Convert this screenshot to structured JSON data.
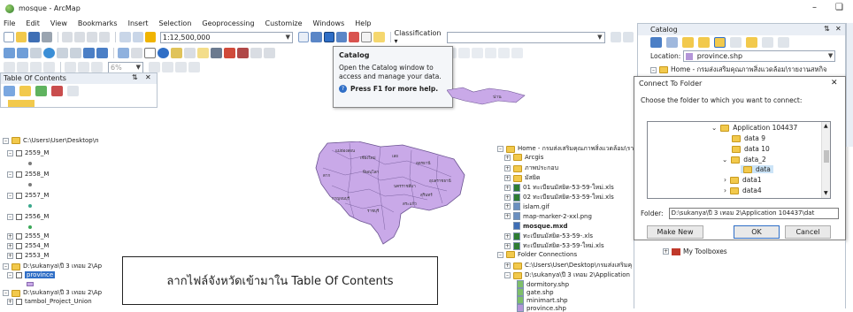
{
  "window": {
    "title": "mosque - ArcMap"
  },
  "menu": [
    "File",
    "Edit",
    "View",
    "Bookmarks",
    "Insert",
    "Selection",
    "Geoprocessing",
    "Customize",
    "Windows",
    "Help"
  ],
  "toolbar": {
    "scale": "1:12,500,000",
    "classification_label": "Classification ▾",
    "zoom_percent": "6%"
  },
  "tooltip": {
    "title": "Catalog",
    "body": "Open the Catalog window to access and manage your data.",
    "help": "Press F1 for more help."
  },
  "toc": {
    "title": "Table Of Contents",
    "items": [
      "C:\\Users\\User\\Desktop\\n",
      "2559_M",
      "2558_M",
      "2557_M",
      "2556_M",
      "2555_M",
      "2554_M",
      "2553_M",
      "D:\\sukanya\\ปี 3 เทอม 2\\Ap",
      "province",
      "D:\\sukanya\\ปี 3 เทอม 2\\Ap",
      "tambol_Project_Union"
    ]
  },
  "map": {
    "caption": "ลากไฟล์จังหวัดเข้ามาใน Table Of Contents"
  },
  "catalog_panel": {
    "title": "Catalog",
    "location_label": "Location:",
    "location_value": "province.shp",
    "home_label": "Home - กรมส่งเสริมคุณภาพสิ่งแวดล้อม\\รายงานสหกิจ",
    "my_toolboxes": "My Toolboxes"
  },
  "catalog_tree": [
    "Home - กรมส่งเสริมคุณภาพสิ่งแวดล้อม\\ราย",
    "Arcgis",
    "ภาพประกอบ",
    "มัสยิด",
    "01 ทะเบียนมัสยิด-53-59-ใหม่.xls",
    "02 ทะเบียนมัสยิด-53-59-ใหม่.xls",
    "islam.gif",
    "map-marker-2-xxl.png",
    "mosque.mxd",
    "ทะเบียนมัสยิด-53-59-.xls",
    "ทะเบียนมัสยิด-53-59-ใหม่.xls",
    "Folder Connections",
    "C:\\Users\\User\\Desktop\\กรมส่งเสริมคุ",
    "D:\\sukanya\\ปี 3 เทอม 2\\Application",
    "dormitory.shp",
    "gate.shp",
    "minimart.shp",
    "province.shp"
  ],
  "dialog": {
    "title": "Connect To Folder",
    "prompt": "Choose the folder to which you want to connect:",
    "tree": [
      "Application 104437",
      "data 9",
      "data 10",
      "data_2",
      "data",
      "data1",
      "data4"
    ],
    "folder_label": "Folder:",
    "folder_value": "D:\\sukanya\\ปี 3 เทอม 2\\Application 104437\\dat",
    "make_new_folder": "Make New Folder",
    "ok": "OK",
    "cancel": "Cancel"
  },
  "map_labels": [
    "แม่ฮ่องสอน",
    "เชียงใหม่",
    "ตาก",
    "กาญจนบุรี",
    "นครราชสีมา",
    "อุบลราชธานี",
    "เลย",
    "อุดรธานี",
    "น่าน",
    "พิษณุโลก",
    "สระแก้ว",
    "ราชบุรี",
    "สุรินทร์"
  ],
  "colors": {
    "accent": "#2f6ec6",
    "map_fill": "#c9a9e8",
    "caption_border": "#222222"
  }
}
